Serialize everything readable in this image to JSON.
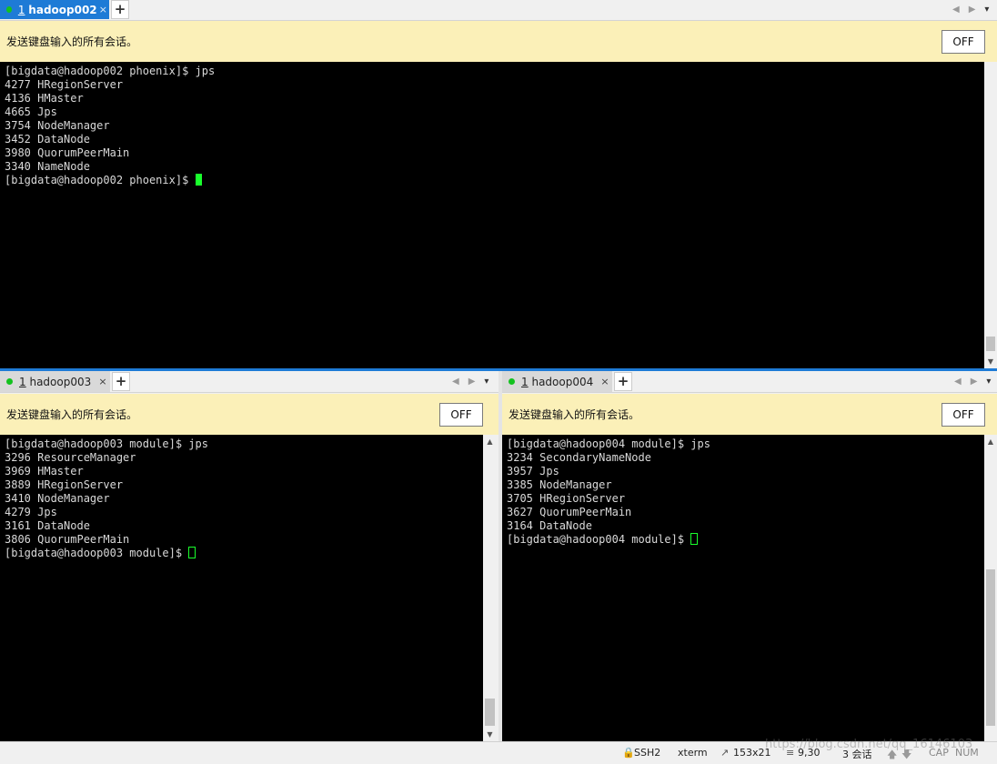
{
  "top": {
    "tab": {
      "num": "1",
      "title": "hadoop002",
      "close": "×"
    },
    "add": "+",
    "banner": "发送键盘输入的所有会话。",
    "off": "OFF",
    "lines": [
      "[bigdata@hadoop002 phoenix]$ jps",
      "4277 HRegionServer",
      "4136 HMaster",
      "4665 Jps",
      "3754 NodeManager",
      "3452 DataNode",
      "3980 QuorumPeerMain",
      "3340 NameNode"
    ],
    "prompt": "[bigdata@hadoop002 phoenix]$ "
  },
  "left": {
    "tab": {
      "num": "1",
      "title": "hadoop003",
      "close": "×"
    },
    "add": "+",
    "banner": "发送键盘输入的所有会话。",
    "off": "OFF",
    "lines": [
      "[bigdata@hadoop003 module]$ jps",
      "3296 ResourceManager",
      "3969 HMaster",
      "3889 HRegionServer",
      "3410 NodeManager",
      "4279 Jps",
      "3161 DataNode",
      "3806 QuorumPeerMain"
    ],
    "prompt": "[bigdata@hadoop003 module]$ "
  },
  "right": {
    "tab": {
      "num": "1",
      "title": "hadoop004",
      "close": "×"
    },
    "add": "+",
    "banner": "发送键盘输入的所有会话。",
    "off": "OFF",
    "lines": [
      "[bigdata@hadoop004 module]$ jps",
      "3234 SecondaryNameNode",
      "3957 Jps",
      "3385 NodeManager",
      "3705 HRegionServer",
      "3627 QuorumPeerMain",
      "3164 DataNode"
    ],
    "prompt": "[bigdata@hadoop004 module]$ "
  },
  "nav": {
    "prev": "◀",
    "next": "▶",
    "menu": "▾"
  },
  "scroll": {
    "up": "▲",
    "down": "▼"
  },
  "status": {
    "protocol": "SSH2",
    "term": "xterm",
    "size": "153x21",
    "pos": "9,30",
    "sessions": "3 会话",
    "caps": "CAP",
    "num": "NUM",
    "watermark": "https://blog.csdn.net/qq_16146103"
  },
  "colors": {
    "active_tab": "#1e7bd6",
    "banner": "#fbf0b8",
    "cursor": "#19ff2c",
    "dot": "#13c21f"
  }
}
